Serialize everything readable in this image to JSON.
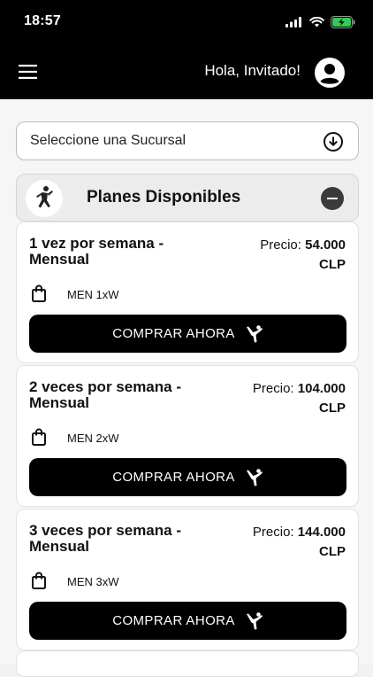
{
  "status_bar": {
    "time": "18:57"
  },
  "app_bar": {
    "greeting": "Hola, Invitado!"
  },
  "branch_select": {
    "label": "Seleccione una Sucursal"
  },
  "plans_section": {
    "title": "Planes Disponibles"
  },
  "plans": [
    {
      "name": "1 vez por semana - Mensual",
      "price_label": "Precio:",
      "price_value": "54.000",
      "currency": "CLP",
      "code": "MEN 1xW",
      "button_label": "COMPRAR AHORA"
    },
    {
      "name": "2 veces por semana - Mensual",
      "price_label": "Precio:",
      "price_value": "104.000",
      "currency": "CLP",
      "code": "MEN 2xW",
      "button_label": "COMPRAR AHORA"
    },
    {
      "name": "3 veces por semana - Mensual",
      "price_label": "Precio:",
      "price_value": "144.000",
      "currency": "CLP",
      "code": "MEN 3xW",
      "button_label": "COMPRAR AHORA"
    }
  ],
  "icons": {
    "menu": "hamburger-menu-icon",
    "avatar": "user-avatar-icon",
    "select": "download-circle-icon",
    "section_badge": "athlete-icon",
    "collapse": "minus-circle-icon",
    "bag": "shopping-bag-icon",
    "buy": "kick-icon"
  },
  "colors": {
    "header_bg": "#000000",
    "button_bg": "#000000",
    "collapse_bg": "#3a3a3a"
  }
}
